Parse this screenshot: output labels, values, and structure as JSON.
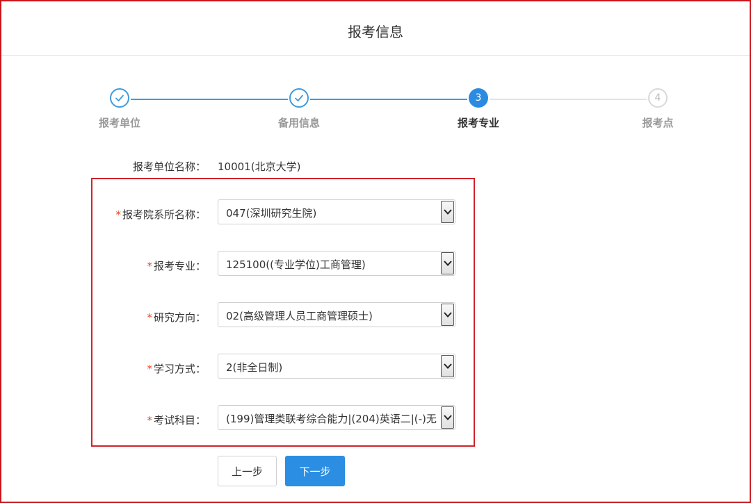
{
  "header": {
    "title": "报考信息"
  },
  "steps": [
    {
      "label": "报考单位",
      "number": "1",
      "state": "done",
      "icon": "check-icon"
    },
    {
      "label": "备用信息",
      "number": "2",
      "state": "done",
      "icon": "check-icon"
    },
    {
      "label": "报考专业",
      "number": "3",
      "state": "active"
    },
    {
      "label": "报考点",
      "number": "4",
      "state": "todo"
    }
  ],
  "form": {
    "unit_label": "报考单位名称：",
    "unit_value": "10001(北京大学)",
    "required_mark": "*",
    "fields": [
      {
        "label": "报考院系所名称：",
        "value": "047(深圳研究生院)"
      },
      {
        "label": "报考专业：",
        "value": "125100((专业学位)工商管理)"
      },
      {
        "label": "研究方向：",
        "value": "02(高级管理人员工商管理硕士)"
      },
      {
        "label": "学习方式：",
        "value": "2(非全日制)"
      },
      {
        "label": "考试科目：",
        "value": "(199)管理类联考综合能力|(204)英语二|(-)无"
      }
    ]
  },
  "buttons": {
    "prev": "上一步",
    "next": "下一步"
  },
  "colors": {
    "accent": "#2b8ee2",
    "highlight_border": "#d0232b",
    "required": "#e8461a"
  }
}
